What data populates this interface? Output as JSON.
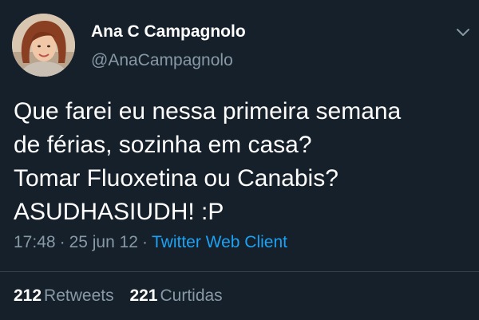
{
  "tweet": {
    "display_name": "Ana C Campagnolo",
    "handle": "@AnaCampagnolo",
    "text_lines": [
      "Que farei eu nessa primeira semana",
      "de férias, sozinha em casa?",
      "Tomar Fluoxetina ou Canabis?",
      "ASUDHASIUDH! :P"
    ],
    "time": "17:48",
    "date": "25 jun 12",
    "separator": "·",
    "client": "Twitter Web Client"
  },
  "stats": {
    "retweets_count": "212",
    "retweets_label": "Retweets",
    "likes_count": "221",
    "likes_label": "Curtidas"
  },
  "icons": {
    "avatar": "profile-photo",
    "menu": "chevron-down-icon"
  },
  "colors": {
    "background": "#15202b",
    "text_primary": "#ffffff",
    "text_secondary": "#8899a6",
    "link": "#1da1f2",
    "divider": "#38444d"
  }
}
